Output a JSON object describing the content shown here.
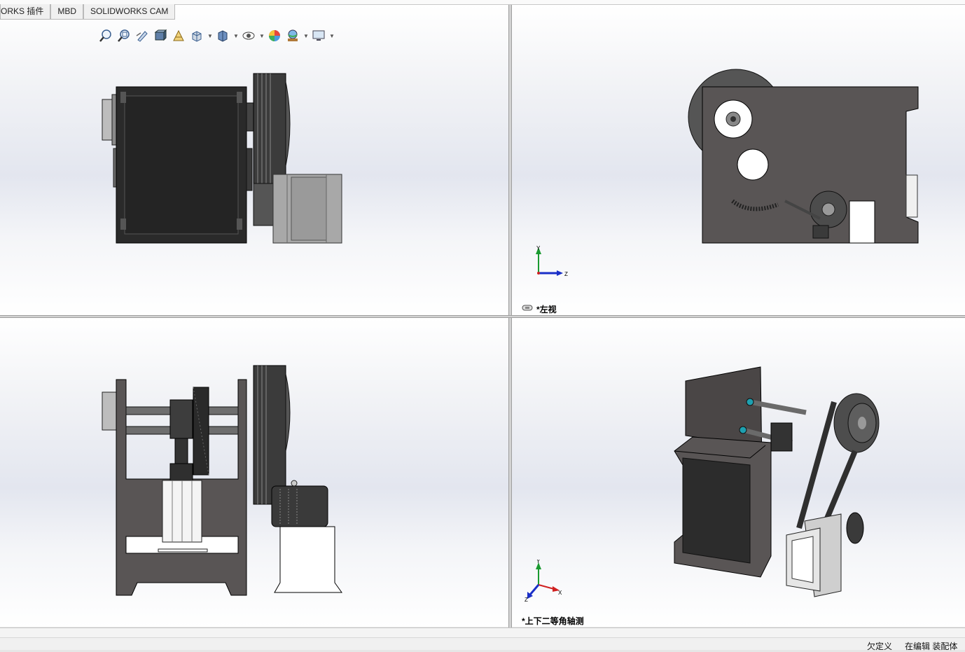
{
  "tabs": [
    {
      "label": "ORKS 插件"
    },
    {
      "label": "MBD"
    },
    {
      "label": "SOLIDWORKS CAM"
    }
  ],
  "view_toolbar": {
    "icons": [
      "zoom-to-fit-icon",
      "zoom-to-area-icon",
      "previous-view-icon",
      "section-view-icon",
      "dynamic-annotation-icon",
      "view-orientation-icon",
      "display-style-icon",
      "hide-show-items-icon",
      "edit-appearance-icon",
      "apply-scene-icon",
      "view-settings-icon"
    ]
  },
  "viewports": {
    "front": {
      "label": ""
    },
    "left": {
      "label": "*左视"
    },
    "bottom": {
      "label": ""
    },
    "iso": {
      "label": "*上下二等角轴测"
    }
  },
  "triad": {
    "x": "X",
    "y": "Y",
    "z": "Z"
  },
  "status": {
    "underdefined": "欠定义",
    "editing": "在编辑 装配体"
  },
  "colors": {
    "model_dark": "#2b2b2b",
    "model_frame": "#595555",
    "model_light": "#a8a8a8",
    "axis_x": "#d02020",
    "axis_y": "#1a9a30",
    "axis_z": "#1a2fc8"
  }
}
